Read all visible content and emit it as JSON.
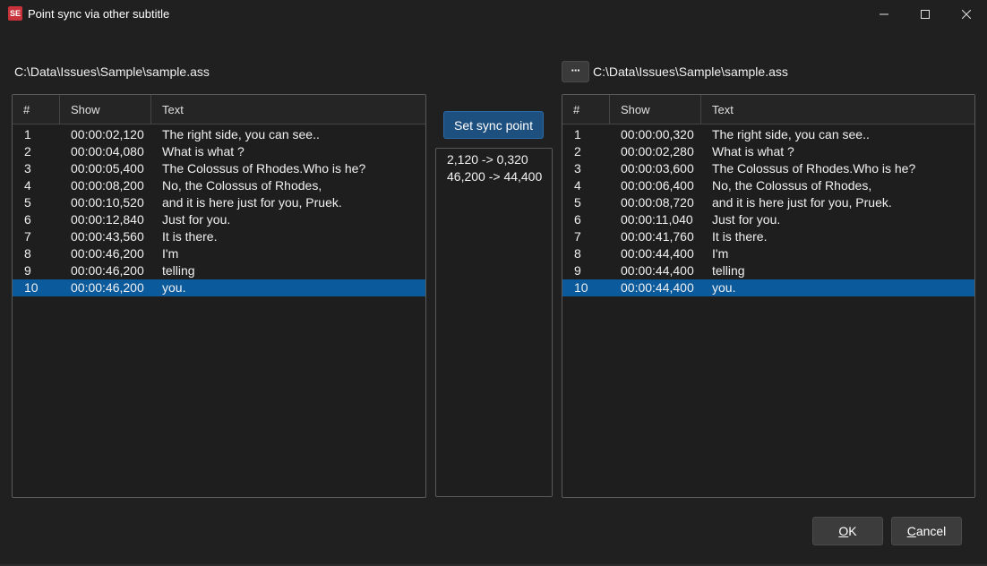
{
  "window": {
    "title": "Point sync via other subtitle",
    "app_icon_text": "SE"
  },
  "left": {
    "file_path": "C:\\Data\\Issues\\Sample\\sample.ass",
    "columns": [
      "#",
      "Show",
      "Text"
    ],
    "rows": [
      {
        "num": "1",
        "show": "00:00:02,120",
        "text": "The right side, you can see.."
      },
      {
        "num": "2",
        "show": "00:00:04,080",
        "text": "What is what ?"
      },
      {
        "num": "3",
        "show": "00:00:05,400",
        "text": "The Colossus of Rhodes.Who is he?"
      },
      {
        "num": "4",
        "show": "00:00:08,200",
        "text": "No, the Colossus of Rhodes,"
      },
      {
        "num": "5",
        "show": "00:00:10,520",
        "text": "and it is here just for you, Pruek."
      },
      {
        "num": "6",
        "show": "00:00:12,840",
        "text": "Just for you."
      },
      {
        "num": "7",
        "show": "00:00:43,560",
        "text": "It is there."
      },
      {
        "num": "8",
        "show": "00:00:46,200",
        "text": "I'm"
      },
      {
        "num": "9",
        "show": "00:00:46,200",
        "text": "telling"
      },
      {
        "num": "10",
        "show": "00:00:46,200",
        "text": "you."
      }
    ],
    "selected_row": "10"
  },
  "right": {
    "browse_label": "···",
    "file_path": "C:\\Data\\Issues\\Sample\\sample.ass",
    "columns": [
      "#",
      "Show",
      "Text"
    ],
    "rows": [
      {
        "num": "1",
        "show": "00:00:00,320",
        "text": "The right side, you can see.."
      },
      {
        "num": "2",
        "show": "00:00:02,280",
        "text": "What is what ?"
      },
      {
        "num": "3",
        "show": "00:00:03,600",
        "text": "The Colossus of Rhodes.Who is he?"
      },
      {
        "num": "4",
        "show": "00:00:06,400",
        "text": "No, the Colossus of Rhodes,"
      },
      {
        "num": "5",
        "show": "00:00:08,720",
        "text": "and it is here just for you, Pruek."
      },
      {
        "num": "6",
        "show": "00:00:11,040",
        "text": "Just for you."
      },
      {
        "num": "7",
        "show": "00:00:41,760",
        "text": "It is there."
      },
      {
        "num": "8",
        "show": "00:00:44,400",
        "text": "I'm"
      },
      {
        "num": "9",
        "show": "00:00:44,400",
        "text": "telling"
      },
      {
        "num": "10",
        "show": "00:00:44,400",
        "text": "you."
      }
    ],
    "selected_row": "10"
  },
  "middle": {
    "set_sync_label": "Set sync point",
    "sync_points": [
      "2,120 -> 0,320",
      "46,200 -> 44,400"
    ]
  },
  "buttons": {
    "ok_mnemonic": "O",
    "ok_rest": "K",
    "cancel_mnemonic": "C",
    "cancel_rest": "ancel"
  },
  "colors": {
    "background": "#202020",
    "selection": "#0a5a9c",
    "accent_button": "#1d4f7f",
    "brand_icon": "#c8323a"
  }
}
